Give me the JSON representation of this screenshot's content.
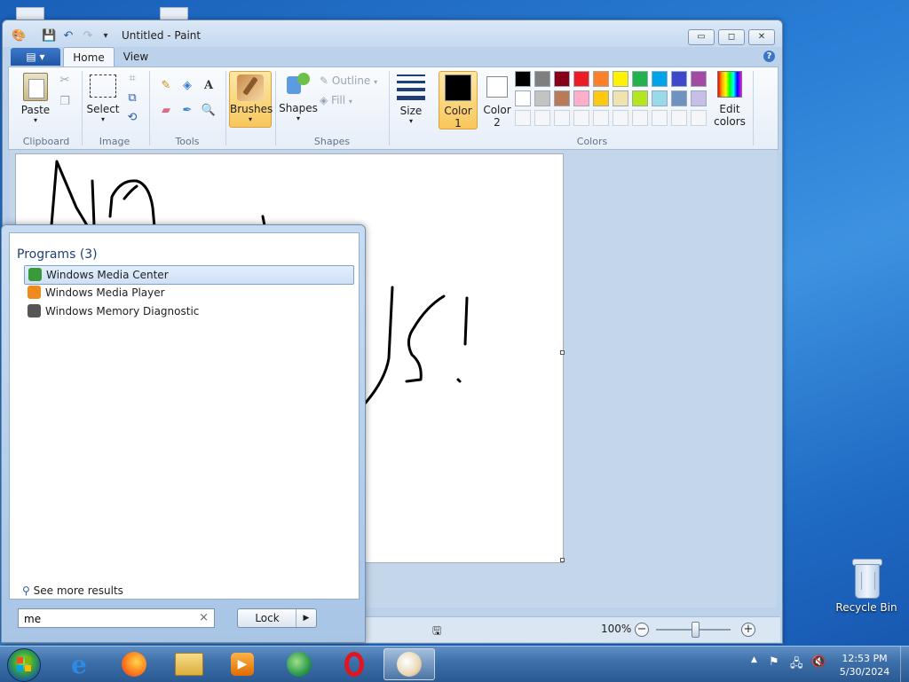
{
  "paint": {
    "title": "Untitled - Paint",
    "file_menu": "▤ ▾",
    "tabs": [
      "Home",
      "View"
    ],
    "ribbon": {
      "clipboard": {
        "group": "Clipboard",
        "paste": "Paste"
      },
      "image": {
        "group": "Image",
        "select": "Select"
      },
      "tools": {
        "group": "Tools"
      },
      "brushes": "Brushes",
      "shapes": {
        "group": "Shapes",
        "shapes": "Shapes",
        "outline": "Outline",
        "fill": "Fill"
      },
      "size": "Size",
      "color1": {
        "label": "Color",
        "num": "1"
      },
      "color2": {
        "label": "Color",
        "num": "2"
      },
      "colors_group": "Colors",
      "edit_colors": {
        "line1": "Edit",
        "line2": "colors"
      }
    },
    "palette_row1": [
      "#000000",
      "#7f7f7f",
      "#880015",
      "#ed1c24",
      "#ff7f27",
      "#fff200",
      "#22b14c",
      "#00a2e8",
      "#3f48cc",
      "#a349a4"
    ],
    "palette_row2": [
      "#ffffff",
      "#c3c3c3",
      "#b97a57",
      "#ffaec9",
      "#ffc90e",
      "#efe4b0",
      "#b5e61d",
      "#99d9ea",
      "#7092be",
      "#c8bfe7"
    ],
    "status": {
      "zoom": "100%"
    }
  },
  "start_menu": {
    "heading": "Programs (3)",
    "programs": [
      {
        "label": "Windows Media Center",
        "icon": "media-center-icon",
        "color": "#3a9a3a"
      },
      {
        "label": "Windows Media Player",
        "icon": "media-player-icon",
        "color": "#f08a1c"
      },
      {
        "label": "Windows Memory Diagnostic",
        "icon": "memory-diagnostic-icon",
        "color": "#555555"
      }
    ],
    "see_more": "See more results",
    "search_value": "me",
    "lock_label": "Lock"
  },
  "desktop": {
    "recycle_bin": "Recycle Bin"
  },
  "taskbar": {
    "items": [
      "internet-explorer-icon",
      "firefox-icon",
      "explorer-icon",
      "media-player-icon",
      "media-center-icon",
      "opera-icon",
      "paint-icon"
    ],
    "time": "12:53 PM",
    "date": "5/30/2024"
  }
}
